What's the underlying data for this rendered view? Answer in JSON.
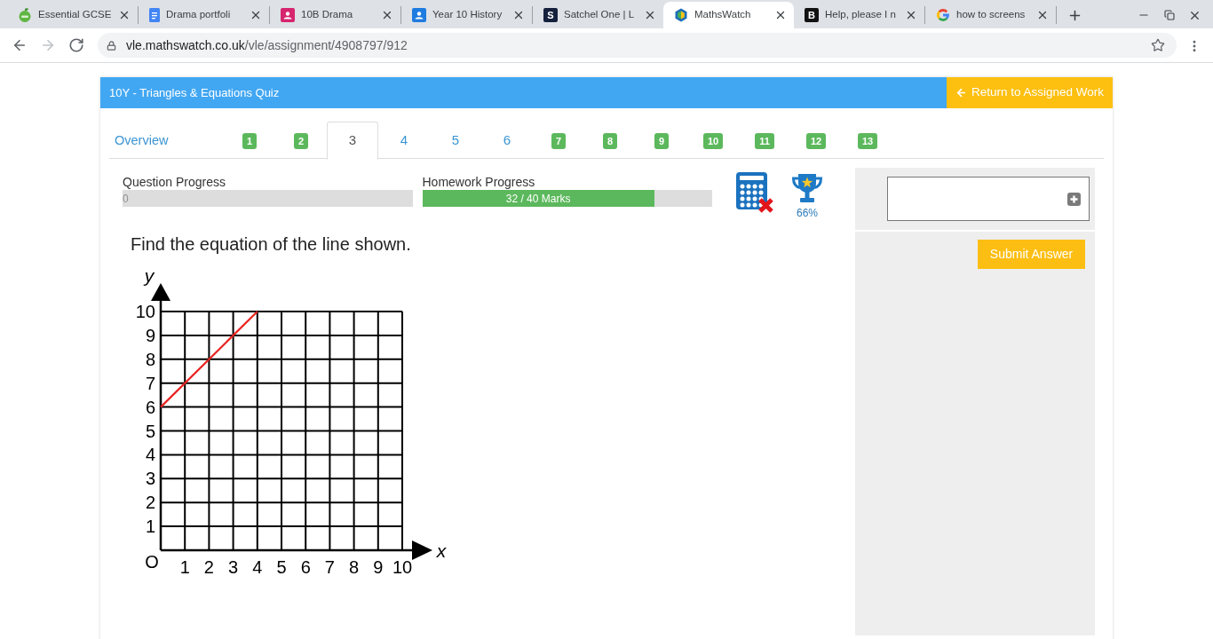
{
  "browser": {
    "tabs": [
      {
        "title": "Essential GCSE",
        "selected": false
      },
      {
        "title": "Drama portfoli",
        "selected": false
      },
      {
        "title": "10B Drama",
        "selected": false
      },
      {
        "title": "Year 10 History",
        "selected": false
      },
      {
        "title": "Satchel One | L",
        "selected": false,
        "icon_text": "S"
      },
      {
        "title": "MathsWatch",
        "selected": true
      },
      {
        "title": "Help, please I n",
        "selected": false,
        "icon_text": "B"
      },
      {
        "title": "how to screens",
        "selected": false
      }
    ],
    "nav_buttons": [
      {
        "kind": "back",
        "disabled": false
      },
      {
        "kind": "forward",
        "disabled": true
      },
      {
        "kind": "reload",
        "disabled": false
      }
    ],
    "url": {
      "host": "vle.mathswatch.co.uk",
      "path": "/vle/assignment/4908797/912"
    }
  },
  "quiz": {
    "title": "10Y - Triangles & Equations Quiz",
    "return_button": "Return to Assigned Work",
    "nav": [
      {
        "label": "Overview",
        "kind": "link",
        "selected": false
      },
      {
        "label": "1",
        "kind": "badge",
        "selected": false
      },
      {
        "label": "2",
        "kind": "badge",
        "selected": false
      },
      {
        "label": "3",
        "kind": "number",
        "selected": true
      },
      {
        "label": "4",
        "kind": "number",
        "selected": false
      },
      {
        "label": "5",
        "kind": "number",
        "selected": false
      },
      {
        "label": "6",
        "kind": "number",
        "selected": false
      },
      {
        "label": "7",
        "kind": "badge",
        "selected": false
      },
      {
        "label": "8",
        "kind": "badge",
        "selected": false
      },
      {
        "label": "9",
        "kind": "badge",
        "selected": false
      },
      {
        "label": "10",
        "kind": "badge",
        "selected": false
      },
      {
        "label": "11",
        "kind": "badge",
        "selected": false
      },
      {
        "label": "12",
        "kind": "badge",
        "selected": false
      },
      {
        "label": "13",
        "kind": "badge",
        "selected": false
      }
    ],
    "progress": [
      {
        "label": "Question Progress",
        "level": 0,
        "reading": "0"
      },
      {
        "label": "Homework Progress",
        "level": 0.8,
        "reading": "32 / 40 Marks"
      }
    ],
    "calculator": {
      "allowed": false
    },
    "score": "66%",
    "question": {
      "text": "Find the equation of the line shown.",
      "chart_data": {
        "type": "line",
        "xlabel": "x",
        "ylabel": "y",
        "x": [
          0,
          4
        ],
        "series": [
          {
            "color": "#e8231f",
            "values": [
              6,
              10
            ]
          }
        ],
        "xlim": [
          0,
          10
        ],
        "ylim": [
          0,
          10
        ],
        "xticks": [
          1,
          2,
          3,
          4,
          5,
          6,
          7,
          8,
          9,
          10
        ],
        "yticks": [
          1,
          2,
          3,
          4,
          5,
          6,
          7,
          8,
          9,
          10
        ],
        "grid": true,
        "annotations": [
          "O"
        ]
      }
    },
    "submit_button": "Submit Answer"
  }
}
